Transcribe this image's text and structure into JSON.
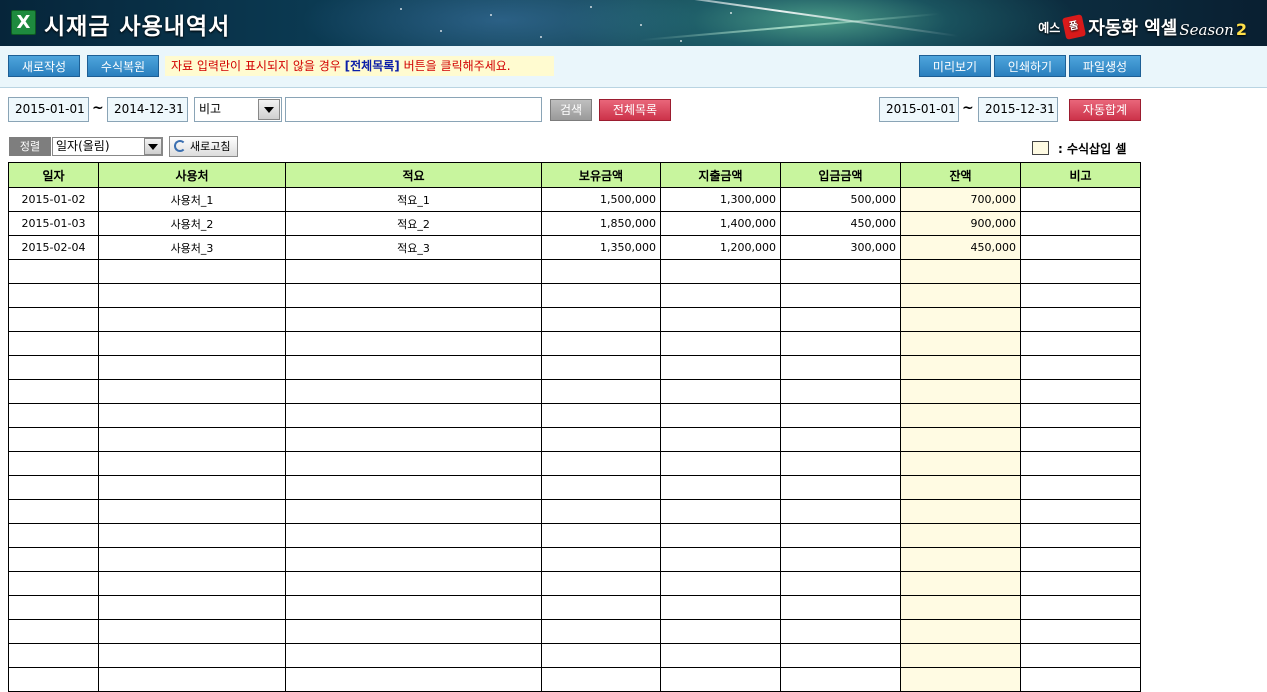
{
  "header": {
    "app_icon": "X",
    "title": "시재금 사용내역서",
    "brand": {
      "prefix": "예스",
      "badge": "폼",
      "name": "자동화 엑셀",
      "season": "Season",
      "season_num": "2"
    }
  },
  "toolbar": {
    "new_label": "새로작성",
    "restore_label": "수식복원",
    "notice_pre": "자료 입력란이 표시되지  않을 경우 ",
    "notice_highlight": "[전체목록]",
    "notice_post": " 버튼을 클릭해주세요.",
    "preview_label": "미리보기",
    "print_label": "인쇄하기",
    "file_label": "파일생성"
  },
  "filter": {
    "start_date": "2015-01-01",
    "tilde": "~",
    "end_date": "2014-12-31",
    "field_select": "비고",
    "search_value": "",
    "search_label": "검색",
    "all_list_label": "전체목록",
    "sum_start_date": "2015-01-01",
    "sum_end_date": "2015-12-31",
    "auto_sum_label": "자동합계"
  },
  "sort": {
    "label": "정렬",
    "value": "일자(올림)",
    "refresh_label": "새로고침",
    "legend_text": ": 수식삽입 셀"
  },
  "table": {
    "columns": [
      "일자",
      "사용처",
      "적요",
      "보유금액",
      "지출금액",
      "입금금액",
      "잔액",
      "비고"
    ],
    "rows": [
      [
        "2015-01-02",
        "사용처_1",
        "적요_1",
        "1,500,000",
        "1,300,000",
        "500,000",
        "700,000",
        ""
      ],
      [
        "2015-01-03",
        "사용처_2",
        "적요_2",
        "1,850,000",
        "1,400,000",
        "450,000",
        "900,000",
        ""
      ],
      [
        "2015-02-04",
        "사용처_3",
        "적요_3",
        "1,350,000",
        "1,200,000",
        "300,000",
        "450,000",
        ""
      ],
      [
        "",
        "",
        "",
        "",
        "",
        "",
        "",
        ""
      ],
      [
        "",
        "",
        "",
        "",
        "",
        "",
        "",
        ""
      ],
      [
        "",
        "",
        "",
        "",
        "",
        "",
        "",
        ""
      ],
      [
        "",
        "",
        "",
        "",
        "",
        "",
        "",
        ""
      ],
      [
        "",
        "",
        "",
        "",
        "",
        "",
        "",
        ""
      ],
      [
        "",
        "",
        "",
        "",
        "",
        "",
        "",
        ""
      ],
      [
        "",
        "",
        "",
        "",
        "",
        "",
        "",
        ""
      ],
      [
        "",
        "",
        "",
        "",
        "",
        "",
        "",
        ""
      ],
      [
        "",
        "",
        "",
        "",
        "",
        "",
        "",
        ""
      ],
      [
        "",
        "",
        "",
        "",
        "",
        "",
        "",
        ""
      ],
      [
        "",
        "",
        "",
        "",
        "",
        "",
        "",
        ""
      ],
      [
        "",
        "",
        "",
        "",
        "",
        "",
        "",
        ""
      ],
      [
        "",
        "",
        "",
        "",
        "",
        "",
        "",
        ""
      ],
      [
        "",
        "",
        "",
        "",
        "",
        "",
        "",
        ""
      ],
      [
        "",
        "",
        "",
        "",
        "",
        "",
        "",
        ""
      ],
      [
        "",
        "",
        "",
        "",
        "",
        "",
        "",
        ""
      ],
      [
        "",
        "",
        "",
        "",
        "",
        "",
        "",
        ""
      ],
      [
        "",
        "",
        "",
        "",
        "",
        "",
        "",
        ""
      ]
    ]
  },
  "colors": {
    "header_green": "#c8f59e",
    "formula_cell": "#fffbe3",
    "toolbar_button": "#2a7fbe",
    "red_button": "#cc3249",
    "notice_text": "#d20000"
  },
  "icons": {
    "app": "excel-x-icon",
    "dropdown": "chevron-down-icon",
    "refresh": "refresh-icon"
  }
}
